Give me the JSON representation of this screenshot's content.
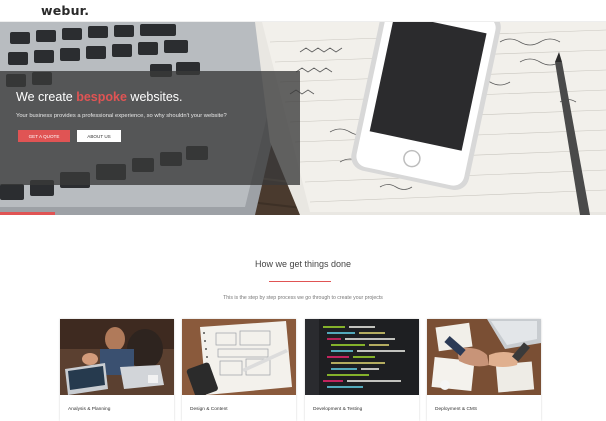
{
  "brand": {
    "logo": "webur."
  },
  "hero": {
    "headline_before": "We create ",
    "headline_accent": "bespoke",
    "headline_after": " websites.",
    "subline": "Your business provides a professional experience, so why shouldn't your website?",
    "primary_button": "GET A QUOTE",
    "secondary_button": "ABOUT US"
  },
  "process": {
    "title": "How we get things done",
    "subtitle": "This is the step by step process we go through to create your projects",
    "cards": [
      {
        "label": "Analysis & Planning",
        "image": "team-meeting-laptops"
      },
      {
        "label": "Design & Content",
        "image": "wireframe-sketch-notebook"
      },
      {
        "label": "Development & Testing",
        "image": "code-editor-screen"
      },
      {
        "label": "Deployment & CMS",
        "image": "handshake-over-desk"
      }
    ]
  },
  "colors": {
    "accent": "#e05454",
    "overlay": "#3a3a3a",
    "text": "#333333"
  }
}
